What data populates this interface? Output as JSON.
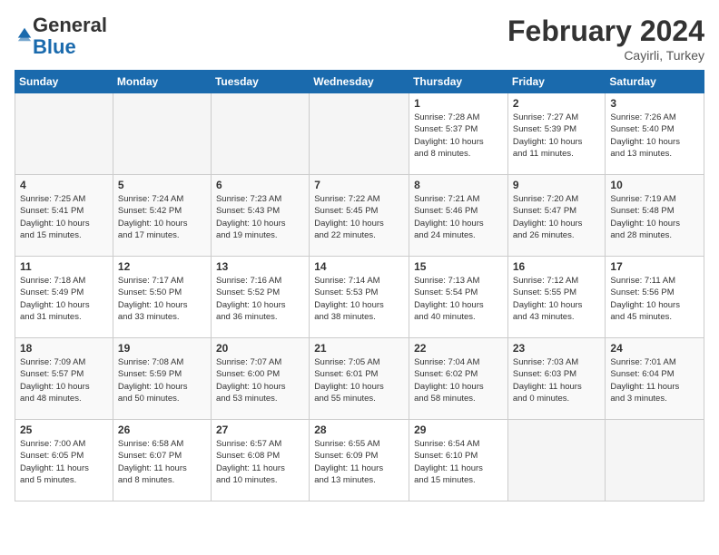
{
  "logo": {
    "general": "General",
    "blue": "Blue"
  },
  "header": {
    "month_year": "February 2024",
    "location": "Cayirli, Turkey"
  },
  "days_of_week": [
    "Sunday",
    "Monday",
    "Tuesday",
    "Wednesday",
    "Thursday",
    "Friday",
    "Saturday"
  ],
  "weeks": [
    [
      {
        "day": "",
        "info": ""
      },
      {
        "day": "",
        "info": ""
      },
      {
        "day": "",
        "info": ""
      },
      {
        "day": "",
        "info": ""
      },
      {
        "day": "1",
        "info": "Sunrise: 7:28 AM\nSunset: 5:37 PM\nDaylight: 10 hours\nand 8 minutes."
      },
      {
        "day": "2",
        "info": "Sunrise: 7:27 AM\nSunset: 5:39 PM\nDaylight: 10 hours\nand 11 minutes."
      },
      {
        "day": "3",
        "info": "Sunrise: 7:26 AM\nSunset: 5:40 PM\nDaylight: 10 hours\nand 13 minutes."
      }
    ],
    [
      {
        "day": "4",
        "info": "Sunrise: 7:25 AM\nSunset: 5:41 PM\nDaylight: 10 hours\nand 15 minutes."
      },
      {
        "day": "5",
        "info": "Sunrise: 7:24 AM\nSunset: 5:42 PM\nDaylight: 10 hours\nand 17 minutes."
      },
      {
        "day": "6",
        "info": "Sunrise: 7:23 AM\nSunset: 5:43 PM\nDaylight: 10 hours\nand 19 minutes."
      },
      {
        "day": "7",
        "info": "Sunrise: 7:22 AM\nSunset: 5:45 PM\nDaylight: 10 hours\nand 22 minutes."
      },
      {
        "day": "8",
        "info": "Sunrise: 7:21 AM\nSunset: 5:46 PM\nDaylight: 10 hours\nand 24 minutes."
      },
      {
        "day": "9",
        "info": "Sunrise: 7:20 AM\nSunset: 5:47 PM\nDaylight: 10 hours\nand 26 minutes."
      },
      {
        "day": "10",
        "info": "Sunrise: 7:19 AM\nSunset: 5:48 PM\nDaylight: 10 hours\nand 28 minutes."
      }
    ],
    [
      {
        "day": "11",
        "info": "Sunrise: 7:18 AM\nSunset: 5:49 PM\nDaylight: 10 hours\nand 31 minutes."
      },
      {
        "day": "12",
        "info": "Sunrise: 7:17 AM\nSunset: 5:50 PM\nDaylight: 10 hours\nand 33 minutes."
      },
      {
        "day": "13",
        "info": "Sunrise: 7:16 AM\nSunset: 5:52 PM\nDaylight: 10 hours\nand 36 minutes."
      },
      {
        "day": "14",
        "info": "Sunrise: 7:14 AM\nSunset: 5:53 PM\nDaylight: 10 hours\nand 38 minutes."
      },
      {
        "day": "15",
        "info": "Sunrise: 7:13 AM\nSunset: 5:54 PM\nDaylight: 10 hours\nand 40 minutes."
      },
      {
        "day": "16",
        "info": "Sunrise: 7:12 AM\nSunset: 5:55 PM\nDaylight: 10 hours\nand 43 minutes."
      },
      {
        "day": "17",
        "info": "Sunrise: 7:11 AM\nSunset: 5:56 PM\nDaylight: 10 hours\nand 45 minutes."
      }
    ],
    [
      {
        "day": "18",
        "info": "Sunrise: 7:09 AM\nSunset: 5:57 PM\nDaylight: 10 hours\nand 48 minutes."
      },
      {
        "day": "19",
        "info": "Sunrise: 7:08 AM\nSunset: 5:59 PM\nDaylight: 10 hours\nand 50 minutes."
      },
      {
        "day": "20",
        "info": "Sunrise: 7:07 AM\nSunset: 6:00 PM\nDaylight: 10 hours\nand 53 minutes."
      },
      {
        "day": "21",
        "info": "Sunrise: 7:05 AM\nSunset: 6:01 PM\nDaylight: 10 hours\nand 55 minutes."
      },
      {
        "day": "22",
        "info": "Sunrise: 7:04 AM\nSunset: 6:02 PM\nDaylight: 10 hours\nand 58 minutes."
      },
      {
        "day": "23",
        "info": "Sunrise: 7:03 AM\nSunset: 6:03 PM\nDaylight: 11 hours\nand 0 minutes."
      },
      {
        "day": "24",
        "info": "Sunrise: 7:01 AM\nSunset: 6:04 PM\nDaylight: 11 hours\nand 3 minutes."
      }
    ],
    [
      {
        "day": "25",
        "info": "Sunrise: 7:00 AM\nSunset: 6:05 PM\nDaylight: 11 hours\nand 5 minutes."
      },
      {
        "day": "26",
        "info": "Sunrise: 6:58 AM\nSunset: 6:07 PM\nDaylight: 11 hours\nand 8 minutes."
      },
      {
        "day": "27",
        "info": "Sunrise: 6:57 AM\nSunset: 6:08 PM\nDaylight: 11 hours\nand 10 minutes."
      },
      {
        "day": "28",
        "info": "Sunrise: 6:55 AM\nSunset: 6:09 PM\nDaylight: 11 hours\nand 13 minutes."
      },
      {
        "day": "29",
        "info": "Sunrise: 6:54 AM\nSunset: 6:10 PM\nDaylight: 11 hours\nand 15 minutes."
      },
      {
        "day": "",
        "info": ""
      },
      {
        "day": "",
        "info": ""
      }
    ]
  ]
}
